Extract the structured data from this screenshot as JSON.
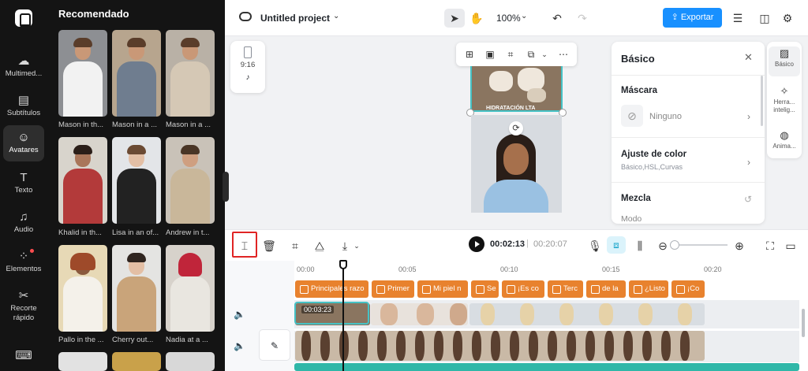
{
  "rail": {
    "items": [
      {
        "label": "Multimed...",
        "icon": "cloud-upload-icon",
        "active": false
      },
      {
        "label": "Subtítulos",
        "icon": "subtitles-icon",
        "active": false
      },
      {
        "label": "Avatares",
        "icon": "avatar-icon",
        "active": true
      },
      {
        "label": "Texto",
        "icon": "text-icon",
        "active": false
      },
      {
        "label": "Audio",
        "icon": "music-note-icon",
        "active": false
      },
      {
        "label": "Elementos",
        "icon": "elements-icon",
        "active": false
      },
      {
        "label": "Recorte rápido",
        "icon": "quick-cut-icon",
        "active": false
      }
    ]
  },
  "panel": {
    "title": "Recomendado",
    "avatars": [
      {
        "caption": "Mason in th..."
      },
      {
        "caption": "Mason in a ..."
      },
      {
        "caption": "Mason in a ..."
      },
      {
        "caption": "Khalid in th..."
      },
      {
        "caption": "Lisa in an of..."
      },
      {
        "caption": "Andrew in t..."
      },
      {
        "caption": "Pallo in the ..."
      },
      {
        "caption": "Cherry out..."
      },
      {
        "caption": "Nadia at a ..."
      }
    ]
  },
  "topbar": {
    "project_title": "Untitled project",
    "zoom": "100%",
    "export_label": "Exportar"
  },
  "format_card": {
    "ratio": "9:16",
    "platform": "♪"
  },
  "video": {
    "overlay_text": "HIDRATACIÓN LTA"
  },
  "props": {
    "title": "Básico",
    "mask_title": "Máscara",
    "mask_value": "Ninguno",
    "color_title": "Ajuste de color",
    "color_sub": "Básico,HSL,Curvas",
    "blend_title": "Mezcla",
    "mode_label": "Modo"
  },
  "right_tabs": [
    {
      "label": "Básico",
      "icon": "image-icon",
      "active": true
    },
    {
      "label": "Herra... intelig...",
      "icon": "magic-wand-icon",
      "active": false
    },
    {
      "label": "Anima...",
      "icon": "animation-icon",
      "active": false
    }
  ],
  "timeline": {
    "current_time": "00:02:13",
    "total_time": "00:20:07",
    "ruler": [
      "00:00",
      "00:05",
      "00:10",
      "00:15",
      "00:20"
    ],
    "captions": [
      "Principales razo",
      "Primer",
      "Mi piel n",
      "Se",
      "¡Es co",
      "Terc",
      "de la",
      "¿Listo",
      "¡Co"
    ],
    "clip_time": "00:03:23"
  },
  "colors": {
    "accent": "#1890ff",
    "caption": "#e8822e",
    "selection": "#45c2c5",
    "highlight_box": "#e02424"
  }
}
